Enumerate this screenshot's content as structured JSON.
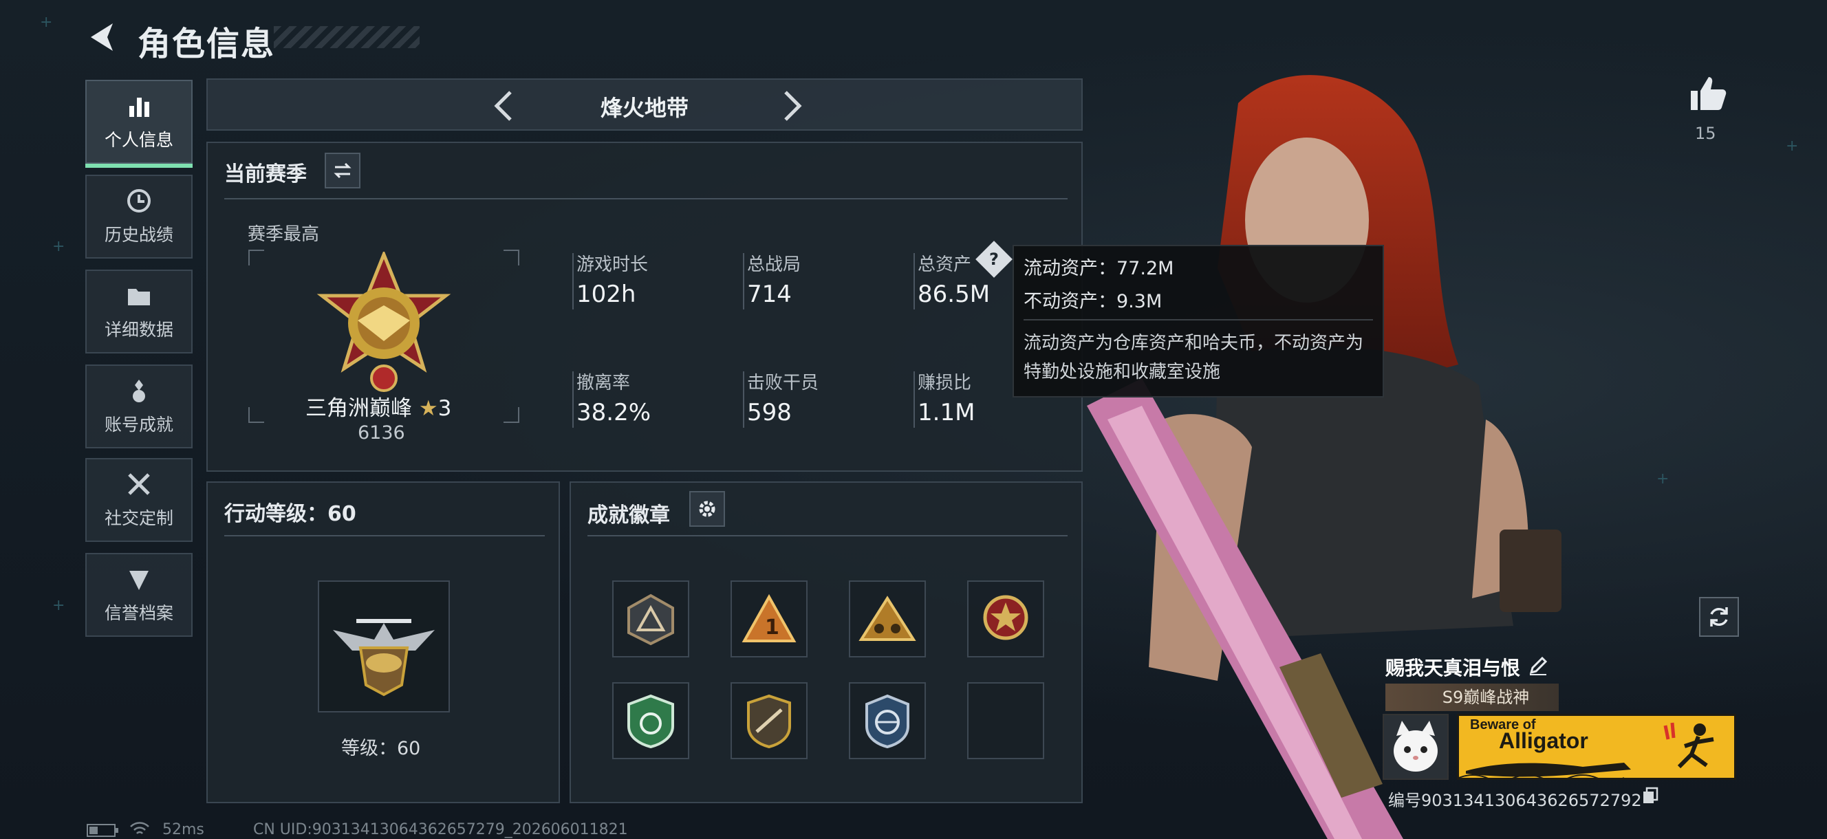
{
  "header": {
    "title": "角色信息"
  },
  "sidebar": {
    "items": [
      {
        "label": "个人信息",
        "icon": "stats-icon",
        "active": true
      },
      {
        "label": "历史战绩",
        "icon": "history-icon",
        "active": false
      },
      {
        "label": "详细数据",
        "icon": "folder-icon",
        "active": false
      },
      {
        "label": "账号成就",
        "icon": "medal-icon",
        "active": false
      },
      {
        "label": "社交定制",
        "icon": "tools-icon",
        "active": false
      },
      {
        "label": "信誉档案",
        "icon": "shield-icon",
        "active": false
      }
    ]
  },
  "mode": {
    "title": "烽火地带"
  },
  "season": {
    "head": "当前赛季",
    "best_label": "赛季最高",
    "rank_name": "三角洲巅峰",
    "rank_stars": "3",
    "rank_score": "6136",
    "stats": [
      {
        "label": "游戏时长",
        "value": "102h"
      },
      {
        "label": "总战局",
        "value": "714"
      },
      {
        "label": "总资产",
        "value": "86.5M"
      },
      {
        "label": "撤离率",
        "value": "38.2%"
      },
      {
        "label": "击败干员",
        "value": "598"
      },
      {
        "label": "赚损比",
        "value": "1.1M"
      }
    ]
  },
  "tooltip": {
    "liquid": "流动资产：77.2M",
    "fixed": "不动资产：9.3M",
    "desc": "流动资产为仓库资产和哈夫币，不动资产为特勤处设施和收藏室设施"
  },
  "action_level": {
    "head": "行动等级：60",
    "level_text": "等级：60"
  },
  "badges": {
    "head": "成就徽章"
  },
  "profile": {
    "likes": "15",
    "name": "赐我天真泪与恨",
    "title_tag": "S9巅峰战神",
    "banner_small": "Beware of",
    "banner_big": "Alligator",
    "id_text": "编号903134130643626572792"
  },
  "footer": {
    "ping": "52ms",
    "uid": "CN UID:903134130643626572​79_202606011821"
  },
  "colors": {
    "accent": "#7fe0b0",
    "gold": "#c9a23a",
    "banner": "#f2b821"
  }
}
